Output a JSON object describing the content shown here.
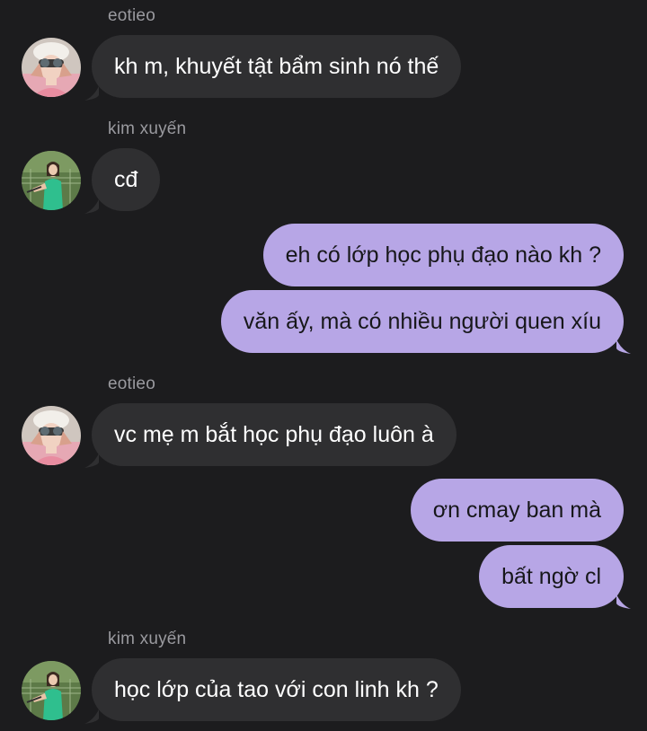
{
  "colors": {
    "background": "#1c1c1e",
    "incoming_bubble": "#2f2f31",
    "outgoing_bubble": "#b7a6e6",
    "name_text": "#9a9a9f"
  },
  "messages": [
    {
      "sender": "eotieo",
      "text": "kh m, khuyết tật bẩm sinh nó thế",
      "direction": "incoming",
      "avatar": "eotieo-avatar"
    },
    {
      "sender": "kim xuyến",
      "text": "cđ",
      "direction": "incoming",
      "avatar": "kim-xuyen-avatar"
    },
    {
      "text": "eh có lớp học phụ đạo nào kh ?",
      "direction": "outgoing"
    },
    {
      "text": "văn ấy, mà có nhiều người quen xíu",
      "direction": "outgoing"
    },
    {
      "sender": "eotieo",
      "text": "vc mẹ m bắt học phụ đạo luôn à",
      "direction": "incoming",
      "avatar": "eotieo-avatar"
    },
    {
      "text": "ơn cmay ban mà",
      "direction": "outgoing"
    },
    {
      "text": "bất ngờ cl",
      "direction": "outgoing"
    },
    {
      "sender": "kim xuyến",
      "text": "học lớp của tao với con linh kh ?",
      "direction": "incoming",
      "avatar": "kim-xuyen-avatar"
    }
  ]
}
